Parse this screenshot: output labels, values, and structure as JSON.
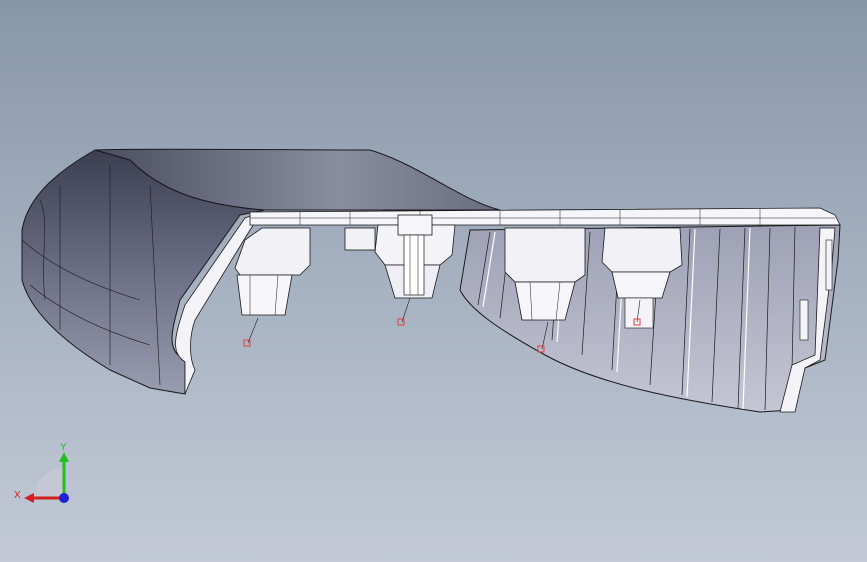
{
  "viewport": {
    "background_top": "#8796a9",
    "background_bottom": "#c3cad6"
  },
  "model": {
    "part_color_dark": "#5a5e72",
    "part_color_light": "#ffffff",
    "edge_color": "#1a1a1a",
    "sketch_point_color": "#e04040"
  },
  "triad": {
    "x_label": "X",
    "y_label": "Y",
    "x_color": "#d42020",
    "y_color": "#20c020",
    "z_color": "#2020d4"
  }
}
